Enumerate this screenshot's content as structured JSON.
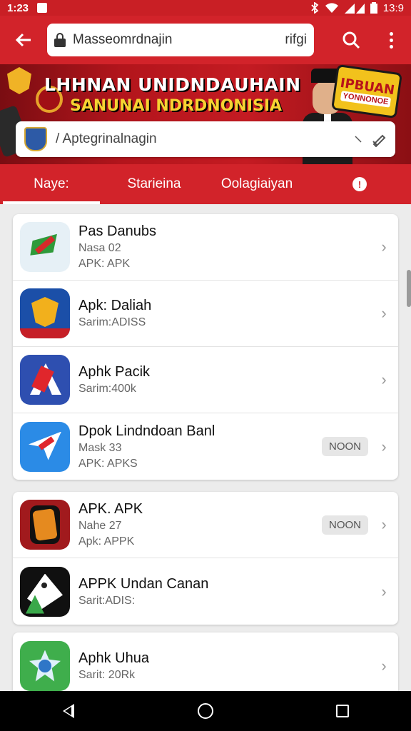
{
  "status_bar": {
    "time": "1:23",
    "clock_right": "13:9",
    "icons": [
      "notification-icon",
      "bluetooth-icon",
      "wifi-icon",
      "signal-icon",
      "battery-icon"
    ]
  },
  "toolbar": {
    "url": "Masseomrdnajin",
    "url_suffix": "rifgi"
  },
  "banner": {
    "title_line1": "LHHNAN UNIDNDAUHAIN",
    "title_line2": "SANUNAI NDRDNONISIA",
    "promo_line1": "IPBUAN",
    "promo_line2": "YONNONOE"
  },
  "search": {
    "text": "/ Aptegrinalnagin"
  },
  "tabs": [
    {
      "label": "Naye:",
      "active": true
    },
    {
      "label": "Starieina",
      "active": false
    },
    {
      "label": "Oolagiaiyan",
      "active": false
    },
    {
      "label": "!",
      "active": false
    }
  ],
  "list_group_1": [
    {
      "name": "Pas Danubs",
      "line2": "Nasa 02",
      "line3": "APK: APK",
      "pill": ""
    },
    {
      "name": "Apk: Daliah",
      "line2": "",
      "line3": "Sarim:ADISS",
      "pill": ""
    },
    {
      "name": "Aphk Pacik",
      "line2": "",
      "line3": "Sarim:400k",
      "pill": ""
    },
    {
      "name": "Dpok Lindndoan Banl",
      "line2": "Mask 33",
      "line3": "APK: APKS",
      "pill": "NOON"
    }
  ],
  "list_group_2": [
    {
      "name": "APK. APK",
      "line2": "Nahe 27",
      "line3": "Apk: APPK",
      "pill": "NOON"
    },
    {
      "name": "APPK Undan Canan",
      "line2": "",
      "line3": "Sarit:ADIS:",
      "pill": ""
    }
  ],
  "list_group_3": [
    {
      "name": "Aphk Uhua",
      "line2": "",
      "line3": "Sarit: 20Rk",
      "pill": ""
    }
  ],
  "colors": {
    "brand_red": "#d2232a",
    "status_red": "#c91f25",
    "banner_yellow": "#f6d332"
  }
}
